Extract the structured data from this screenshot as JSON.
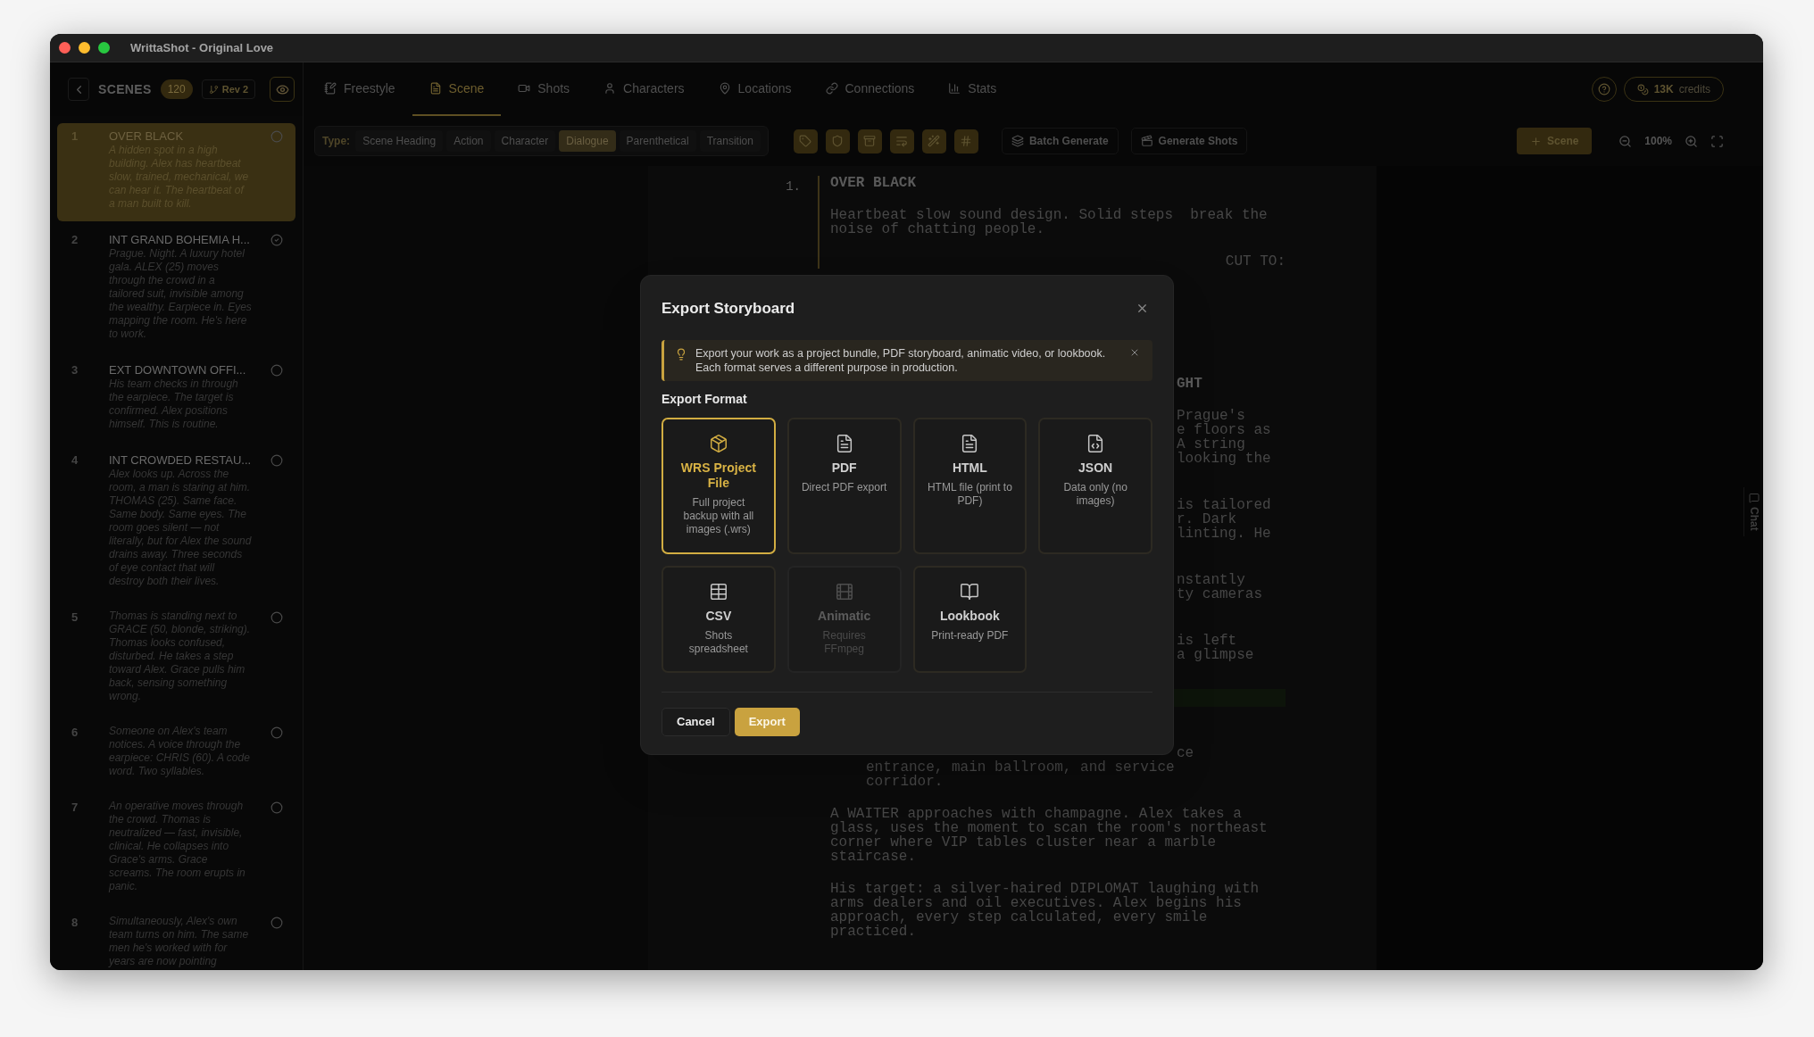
{
  "window": {
    "title": "WrittaShot - Original Love"
  },
  "scenes_header": {
    "title": "SCENES",
    "count": "120",
    "revision": "Rev 2"
  },
  "tabs": [
    {
      "label": "Freestyle",
      "selected": false
    },
    {
      "label": "Scene",
      "selected": true
    },
    {
      "label": "Shots",
      "selected": false
    },
    {
      "label": "Characters",
      "selected": false
    },
    {
      "label": "Locations",
      "selected": false
    },
    {
      "label": "Connections",
      "selected": false
    },
    {
      "label": "Stats",
      "selected": false
    }
  ],
  "credits": {
    "amount": "13K",
    "label": "credits"
  },
  "type_bar": {
    "label": "Type:",
    "options": [
      {
        "label": "Scene Heading",
        "selected": false
      },
      {
        "label": "Action",
        "selected": false
      },
      {
        "label": "Character",
        "selected": false
      },
      {
        "label": "Dialogue",
        "selected": true
      },
      {
        "label": "Parenthetical",
        "selected": false
      },
      {
        "label": "Transition",
        "selected": false
      }
    ]
  },
  "actions": [
    {
      "label": "Batch Generate"
    },
    {
      "label": "Generate Shots"
    }
  ],
  "add_scene": "Scene",
  "zoom_level": "100%",
  "scenes": [
    {
      "number": "1",
      "title": "OVER BLACK",
      "description": "A hidden spot in a high building. Alex has heartbeat slow, trained, mechanical, we can hear it. The heartbeat of a man built to kill.",
      "selected": true,
      "done": false
    },
    {
      "number": "2",
      "title": "INT GRAND BOHEMIA H...",
      "description": "Prague. Night. A luxury hotel gala. ALEX (25) moves through the crowd in a tailored suit, invisible among the wealthy. Earpiece in. Eyes mapping the room. He's here to work.",
      "selected": false,
      "done": true
    },
    {
      "number": "3",
      "title": "EXT DOWNTOWN OFFI...",
      "description": "His team checks in through the earpiece. The target is confirmed. Alex positions himself. This is routine.",
      "selected": false,
      "done": false
    },
    {
      "number": "4",
      "title": "INT CROWDED RESTAU...",
      "description": "Alex looks up. Across the room, a man is staring at him. THOMAS (25). Same face. Same body. Same eyes. The room goes silent — not literally, but for Alex the sound drains away. Three seconds of eye contact that will destroy both their lives.",
      "selected": false,
      "done": false
    },
    {
      "number": "5",
      "description": "Thomas is standing next to GRACE (50, blonde, striking). Thomas looks confused, disturbed. He takes a step toward Alex. Grace pulls him back, sensing something wrong.",
      "selected": false,
      "done": false
    },
    {
      "number": "6",
      "description": "Someone on Alex's team notices. A voice through the earpiece: CHRIS (60). A code word. Two syllables.",
      "selected": false,
      "done": false
    },
    {
      "number": "7",
      "description": "An operative moves through the crowd. Thomas is neutralized — fast, invisible, clinical. He collapses into Grace's arms. Grace screams. The room erupts in panic.",
      "selected": false,
      "done": false
    },
    {
      "number": "8",
      "description": "Simultaneously, Alex's own team turns on him. The same men he's worked with for years are now pointing",
      "selected": false,
      "done": false
    }
  ],
  "script": {
    "scenes": [
      {
        "number": "1.",
        "selected": true,
        "blocks": [
          {
            "kind": "heading",
            "lines": [
              {
                "text": "OVER BLACK",
                "clipped": false
              }
            ]
          },
          {
            "kind": "action",
            "lines": [
              {
                "text": "Heartbeat slow sound design. Solid steps  break the",
                "clipped": false
              },
              {
                "text": "noise of chatting people.",
                "clipped": false
              }
            ]
          },
          {
            "kind": "transition",
            "lines": [
              {
                "text": "CUT TO:",
                "clipped": false
              }
            ]
          }
        ]
      },
      {
        "selected": false,
        "blocks": [
          {
            "kind": "heading",
            "lines": [
              {
                "text": "GHT",
                "clipped": true
              }
            ]
          },
          {
            "kind": "action",
            "lines": [
              {
                "text": "Prague's",
                "clipped": true
              },
              {
                "text": "e floors as",
                "clipped": true
              },
              {
                "text": "A string",
                "clipped": true
              },
              {
                "text": "looking the",
                "clipped": true
              }
            ]
          },
          {
            "kind": "action",
            "lines": [
              {
                "text": "is tailored",
                "clipped": true
              },
              {
                "text": "r. Dark",
                "clipped": true
              },
              {
                "text": "linting. He",
                "clipped": true
              }
            ]
          },
          {
            "kind": "action",
            "lines": [
              {
                "text": "nstantly",
                "clipped": true
              },
              {
                "text": "ty cameras",
                "clipped": true
              }
            ]
          },
          {
            "kind": "action",
            "lines": [
              {
                "text": "is left",
                "clipped": true
              },
              {
                "text": "a glimpse",
                "clipped": true
              }
            ]
          },
          {
            "kind": "highlight"
          },
          {
            "kind": "dialogue",
            "lines": [
              {
                "text": "ce",
                "clipped": true
              },
              {
                "text": "entrance, main ballroom, and service",
                "clipped": false
              },
              {
                "text": "corridor.",
                "clipped": false
              }
            ]
          },
          {
            "kind": "action",
            "lines": [
              {
                "text": "A WAITER approaches with champagne. Alex takes a",
                "clipped": false
              },
              {
                "text": "glass, uses the moment to scan the room's northeast",
                "clipped": false
              },
              {
                "text": "corner where VIP tables cluster near a marble",
                "clipped": false
              },
              {
                "text": "staircase.",
                "clipped": false
              }
            ]
          },
          {
            "kind": "action",
            "lines": [
              {
                "text": "His target: a silver-haired DIPLOMAT laughing with",
                "clipped": false
              },
              {
                "text": "arms dealers and oil executives. Alex begins his",
                "clipped": false
              },
              {
                "text": "approach, every step calculated, every smile",
                "clipped": false
              },
              {
                "text": "practiced.",
                "clipped": false
              }
            ]
          }
        ]
      }
    ]
  },
  "chat_tab": "Chat",
  "dialog": {
    "title": "Export Storyboard",
    "notice": "Export your work as a project bundle, PDF storyboard, animatic video, or lookbook. Each format serves a different purpose in production.",
    "section": "Export Format",
    "formats": [
      {
        "name": "WRS Project File",
        "description": "Full project backup with all images (.wrs)",
        "selected": true,
        "disabled": false
      },
      {
        "name": "PDF",
        "description": "Direct PDF export",
        "selected": false,
        "disabled": false
      },
      {
        "name": "HTML",
        "description": "HTML file (print to PDF)",
        "selected": false,
        "disabled": false
      },
      {
        "name": "JSON",
        "description": "Data only (no images)",
        "selected": false,
        "disabled": false
      },
      {
        "name": "CSV",
        "description": "Shots spreadsheet",
        "selected": false,
        "disabled": false
      },
      {
        "name": "Animatic",
        "description": "Requires FFmpeg",
        "selected": false,
        "disabled": true
      },
      {
        "name": "Lookbook",
        "description": "Print-ready PDF",
        "selected": false,
        "disabled": false
      }
    ],
    "cancel": "Cancel",
    "confirm": "Export"
  }
}
